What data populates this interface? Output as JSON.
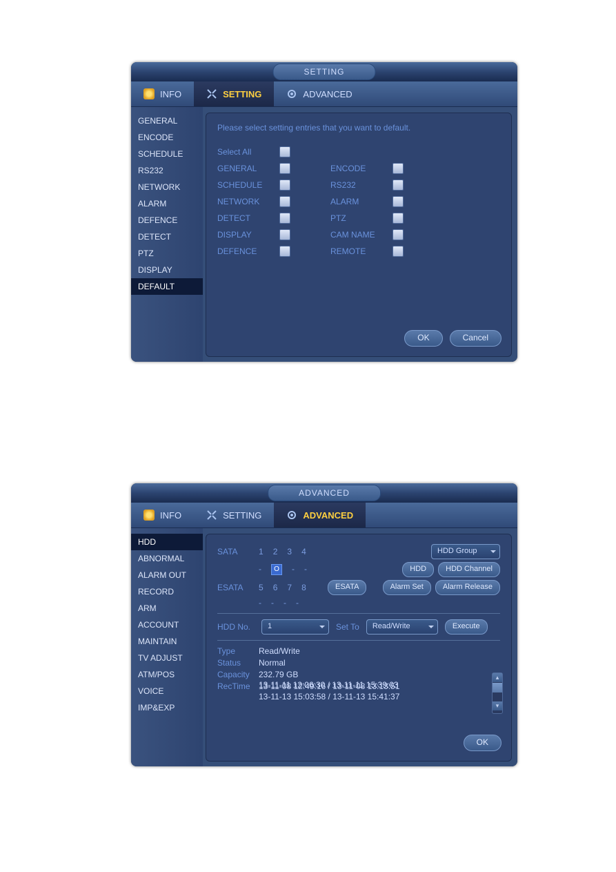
{
  "panel1": {
    "title": "SETTING",
    "tabs": [
      {
        "label": "INFO"
      },
      {
        "label": "SETTING"
      },
      {
        "label": "ADVANCED"
      }
    ],
    "sidebar": [
      "GENERAL",
      "ENCODE",
      "SCHEDULE",
      "RS232",
      "NETWORK",
      "ALARM",
      "DEFENCE",
      "DETECT",
      "PTZ",
      "DISPLAY",
      "DEFAULT"
    ],
    "sidebar_active": "DEFAULT",
    "heading": "Please select setting entries that you want to default.",
    "select_all": "Select All",
    "checks_left": [
      "GENERAL",
      "SCHEDULE",
      "NETWORK",
      "DETECT",
      "DISPLAY",
      "DEFENCE"
    ],
    "checks_right": [
      "ENCODE",
      "RS232",
      "ALARM",
      "PTZ",
      "CAM NAME",
      "REMOTE"
    ],
    "ok": "OK",
    "cancel": "Cancel"
  },
  "panel2": {
    "title": "ADVANCED",
    "tabs": [
      {
        "label": "INFO"
      },
      {
        "label": "SETTING"
      },
      {
        "label": "ADVANCED"
      }
    ],
    "sidebar": [
      "HDD",
      "ABNORMAL",
      "ALARM OUT",
      "RECORD",
      "ARM",
      "ACCOUNT",
      "MAINTAIN",
      "TV ADJUST",
      "ATM/POS",
      "VOICE",
      "IMP&EXP"
    ],
    "sidebar_active": "HDD",
    "sata_label": "SATA",
    "sata_nums": [
      "1",
      "2",
      "3",
      "4"
    ],
    "sata_states": [
      "-",
      "O",
      "-",
      "-"
    ],
    "esata_label": "ESATA",
    "esata_nums": [
      "5",
      "6",
      "7",
      "8"
    ],
    "esata_states": [
      "-",
      "-",
      "-",
      "-"
    ],
    "hdd_group": "HDD Group",
    "btn_hdd": "HDD",
    "btn_hdd_channel": "HDD Channel",
    "btn_esata": "ESATA",
    "btn_alarm_set": "Alarm Set",
    "btn_alarm_release": "Alarm Release",
    "hdd_no_label": "HDD No.",
    "hdd_no_value": "1",
    "set_to_label": "Set To",
    "set_to_value": "Read/Write",
    "btn_execute": "Execute",
    "type_label": "Type",
    "type_value": "Read/Write",
    "status_label": "Status",
    "status_value": "Normal",
    "capacity_label": "Capacity",
    "capacity_value": "232.79 GB",
    "rectime_label": "RecTime",
    "rectimes": [
      "13-11-08 12:49:16 / 13-11-08 13:13:51",
      "13-11-11 12:06:30 / 13-11-11 15:39:03",
      "13-11-13 15:03:58 / 13-11-13 15:41:37"
    ],
    "ok": "OK"
  }
}
